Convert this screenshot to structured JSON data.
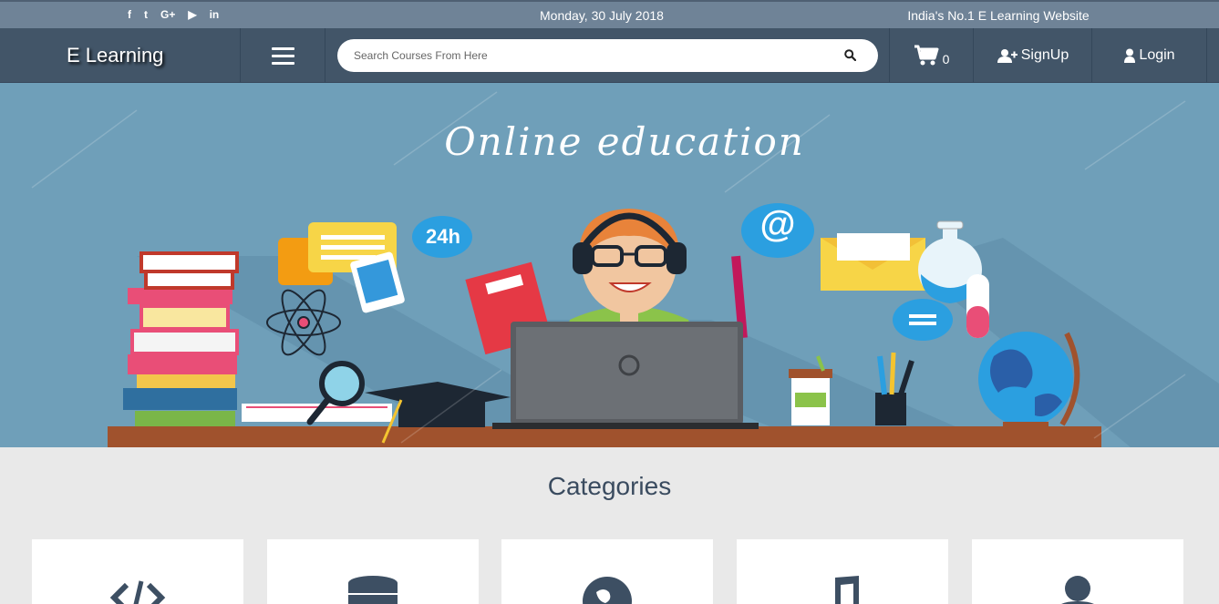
{
  "topbar": {
    "social": [
      {
        "icon": "facebook-icon",
        "glyph": "f"
      },
      {
        "icon": "twitter-icon",
        "glyph": "t"
      },
      {
        "icon": "google-plus-icon",
        "glyph": "G+"
      },
      {
        "icon": "youtube-icon",
        "glyph": "▶"
      },
      {
        "icon": "linkedin-icon",
        "glyph": "in"
      }
    ],
    "date": "Monday, 30 July 2018",
    "slogan": "India's No.1 E Learning Website"
  },
  "navbar": {
    "brand": "E Learning",
    "search_placeholder": "Search Courses From Here",
    "cart_count": "0",
    "signup_label": "SignUp",
    "login_label": "Login"
  },
  "hero": {
    "title": "Online education",
    "badge_24h": "24h",
    "at_symbol": "@"
  },
  "categories": {
    "title": "Categories",
    "items": [
      {
        "icon": "code-icon"
      },
      {
        "icon": "database-icon"
      },
      {
        "icon": "globe-icon"
      },
      {
        "icon": "music-note-icon"
      },
      {
        "icon": "user-icon"
      }
    ]
  },
  "colors": {
    "topbar": "#6f8397",
    "navbar": "#425568",
    "hero_bg": "#6f9fb9",
    "page_bg": "#e9e9e9"
  }
}
